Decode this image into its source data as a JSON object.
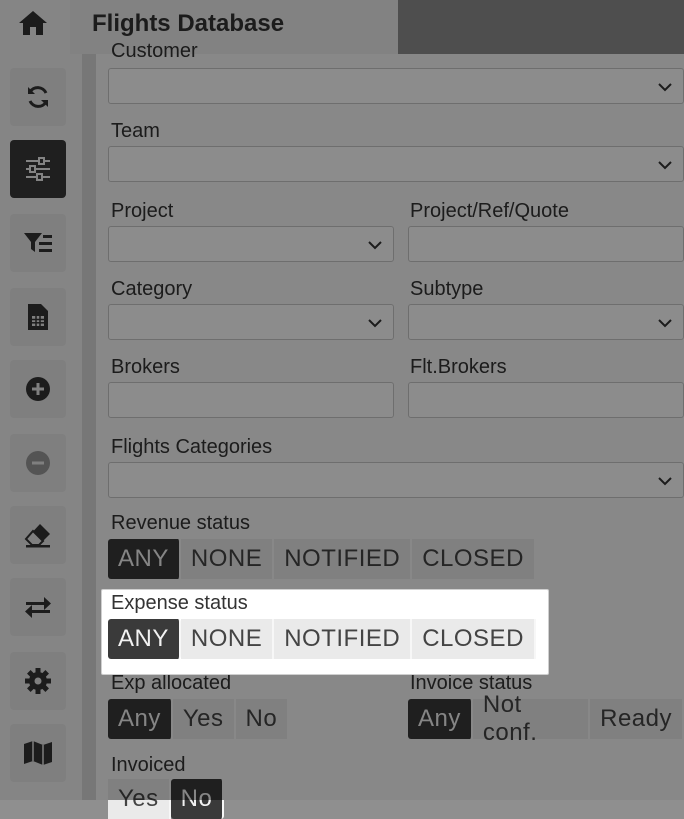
{
  "header": {
    "title": "Flights Database"
  },
  "rail": {
    "icons": [
      "home-icon",
      "refresh-icon",
      "sliders-icon",
      "filter-list-icon",
      "spreadsheet-icon",
      "plus-circle-icon",
      "minus-circle-icon",
      "eraser-icon",
      "swap-icon",
      "gear-icon",
      "map-icon"
    ]
  },
  "form": {
    "customer": {
      "label": "Customer"
    },
    "team": {
      "label": "Team"
    },
    "project": {
      "label": "Project"
    },
    "project_ref": {
      "label": "Project/Ref/Quote"
    },
    "category": {
      "label": "Category"
    },
    "subtype": {
      "label": "Subtype"
    },
    "brokers": {
      "label": "Brokers"
    },
    "flt_brokers": {
      "label": "Flt.Brokers"
    },
    "flights_categories": {
      "label": "Flights Categories"
    },
    "revenue_status": {
      "label": "Revenue status",
      "options": [
        "ANY",
        "NONE",
        "NOTIFIED",
        "CLOSED"
      ],
      "selected": "ANY"
    },
    "expense_status": {
      "label": "Expense status",
      "options": [
        "ANY",
        "NONE",
        "NOTIFIED",
        "CLOSED"
      ],
      "selected": "ANY"
    },
    "exp_allocated": {
      "label": "Exp allocated",
      "options": [
        "Any",
        "Yes",
        "No"
      ],
      "selected": "Any"
    },
    "invoice_status": {
      "label": "Invoice status",
      "options": [
        "Any",
        "Not conf.",
        "Ready"
      ],
      "selected": "Any"
    },
    "invoiced": {
      "label": "Invoiced",
      "options": [
        "Yes",
        "No"
      ],
      "selected": "No"
    }
  }
}
